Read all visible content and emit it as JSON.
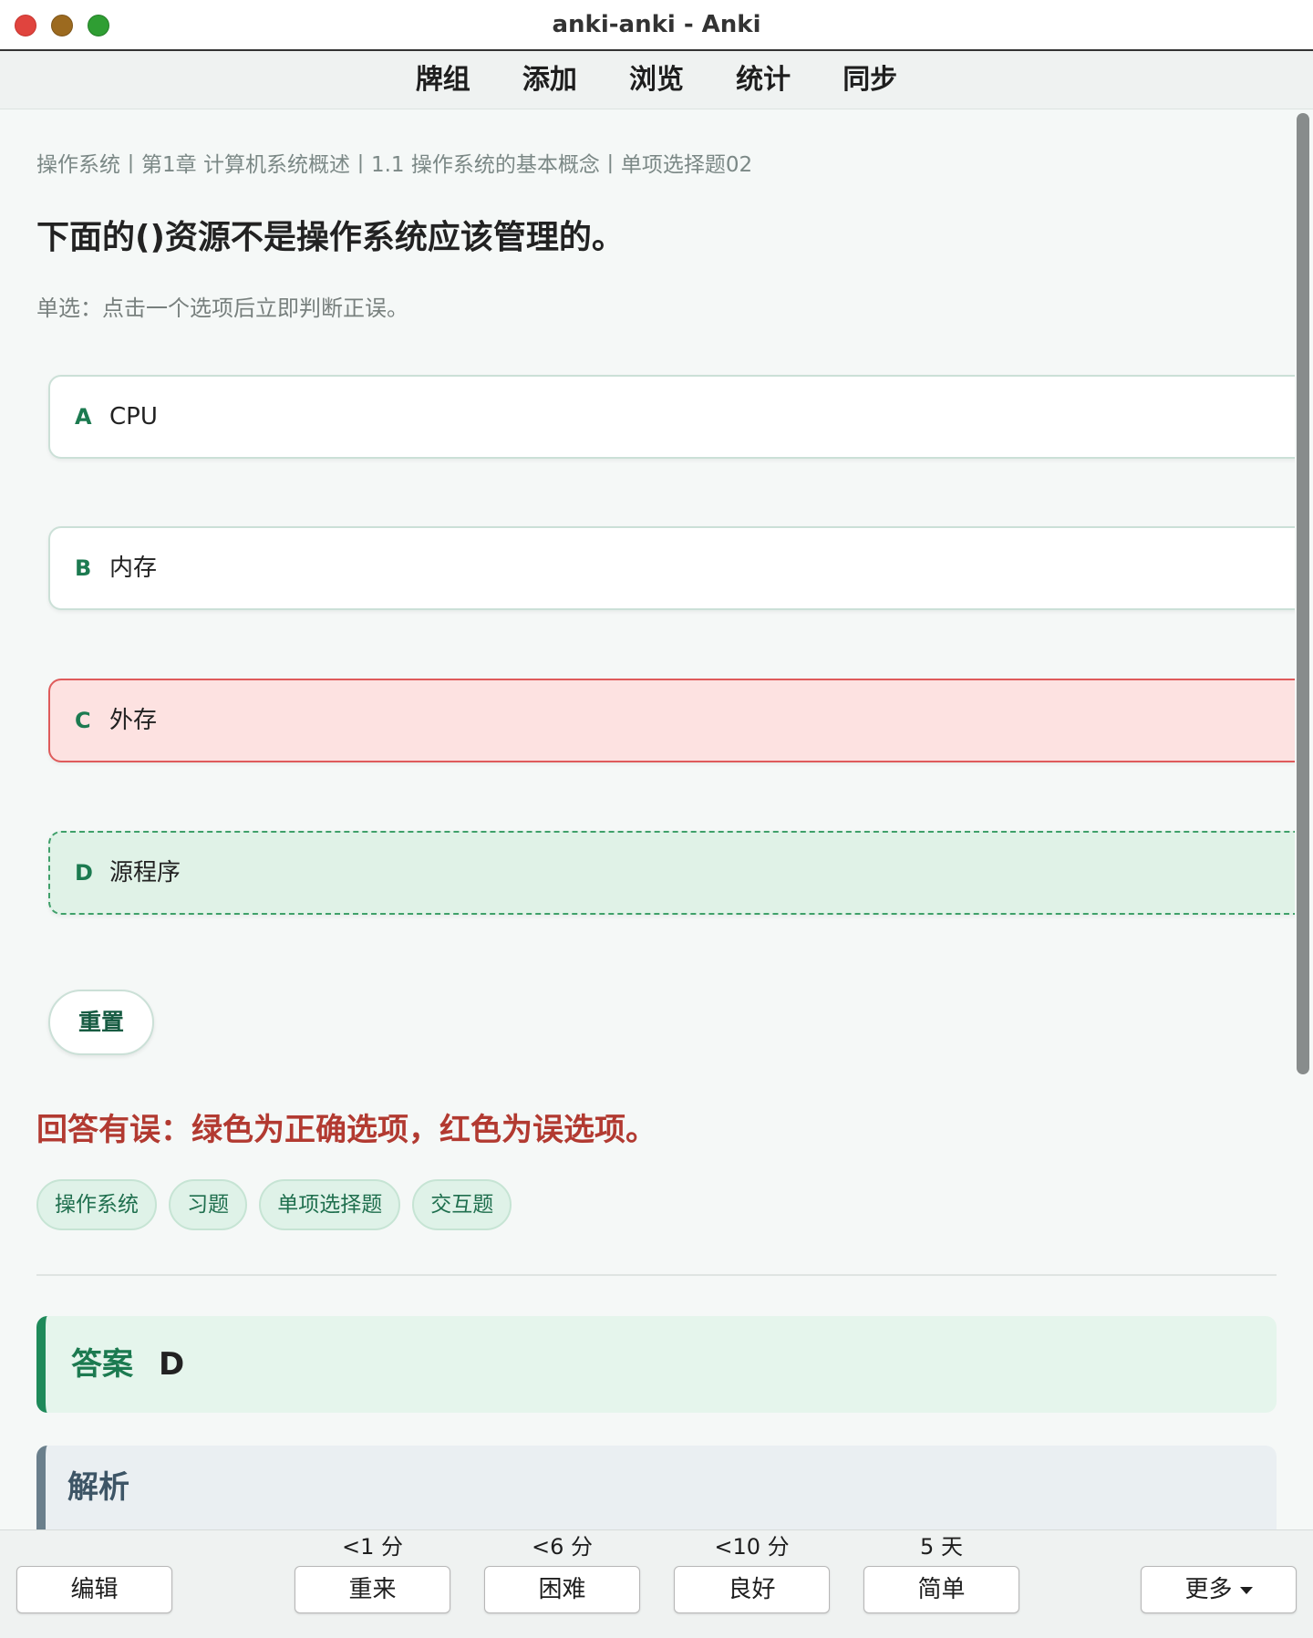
{
  "window": {
    "title": "anki-anki - Anki"
  },
  "nav": {
    "items": [
      "牌组",
      "添加",
      "浏览",
      "统计",
      "同步"
    ]
  },
  "card": {
    "breadcrumb": "操作系统丨第1章 计算机系统概述丨1.1 操作系统的基本概念丨单项选择题02",
    "question": "下面的()资源不是操作系统应该管理的。",
    "hint": "单选：点击一个选项后立即判断正误。",
    "options": [
      {
        "letter": "A",
        "text": "CPU",
        "state": "neutral"
      },
      {
        "letter": "B",
        "text": "内存",
        "state": "neutral"
      },
      {
        "letter": "C",
        "text": "外存",
        "state": "wrong"
      },
      {
        "letter": "D",
        "text": "源程序",
        "state": "correct"
      }
    ],
    "reset_label": "重置",
    "result_message": "回答有误：绿色为正确选项，红色为误选项。",
    "tags": [
      "操作系统",
      "习题",
      "单项选择题",
      "交互题"
    ],
    "answer_label": "答案",
    "answer_value": "D",
    "explanation_label": "解析"
  },
  "bottom": {
    "edit_label": "编辑",
    "more_label": "更多",
    "ease_buttons": [
      {
        "label": "重来",
        "interval": "<1 分"
      },
      {
        "label": "困难",
        "interval": "<6 分"
      },
      {
        "label": "良好",
        "interval": "<10 分"
      },
      {
        "label": "简单",
        "interval": "5 天"
      }
    ]
  },
  "colors": {
    "correct_border": "#3fa06a",
    "correct_bg": "#e0f2e7",
    "wrong_border": "#df5b5b",
    "wrong_bg": "#fde2e1",
    "accent_green": "#1c7a50",
    "error_text": "#b23a31"
  }
}
